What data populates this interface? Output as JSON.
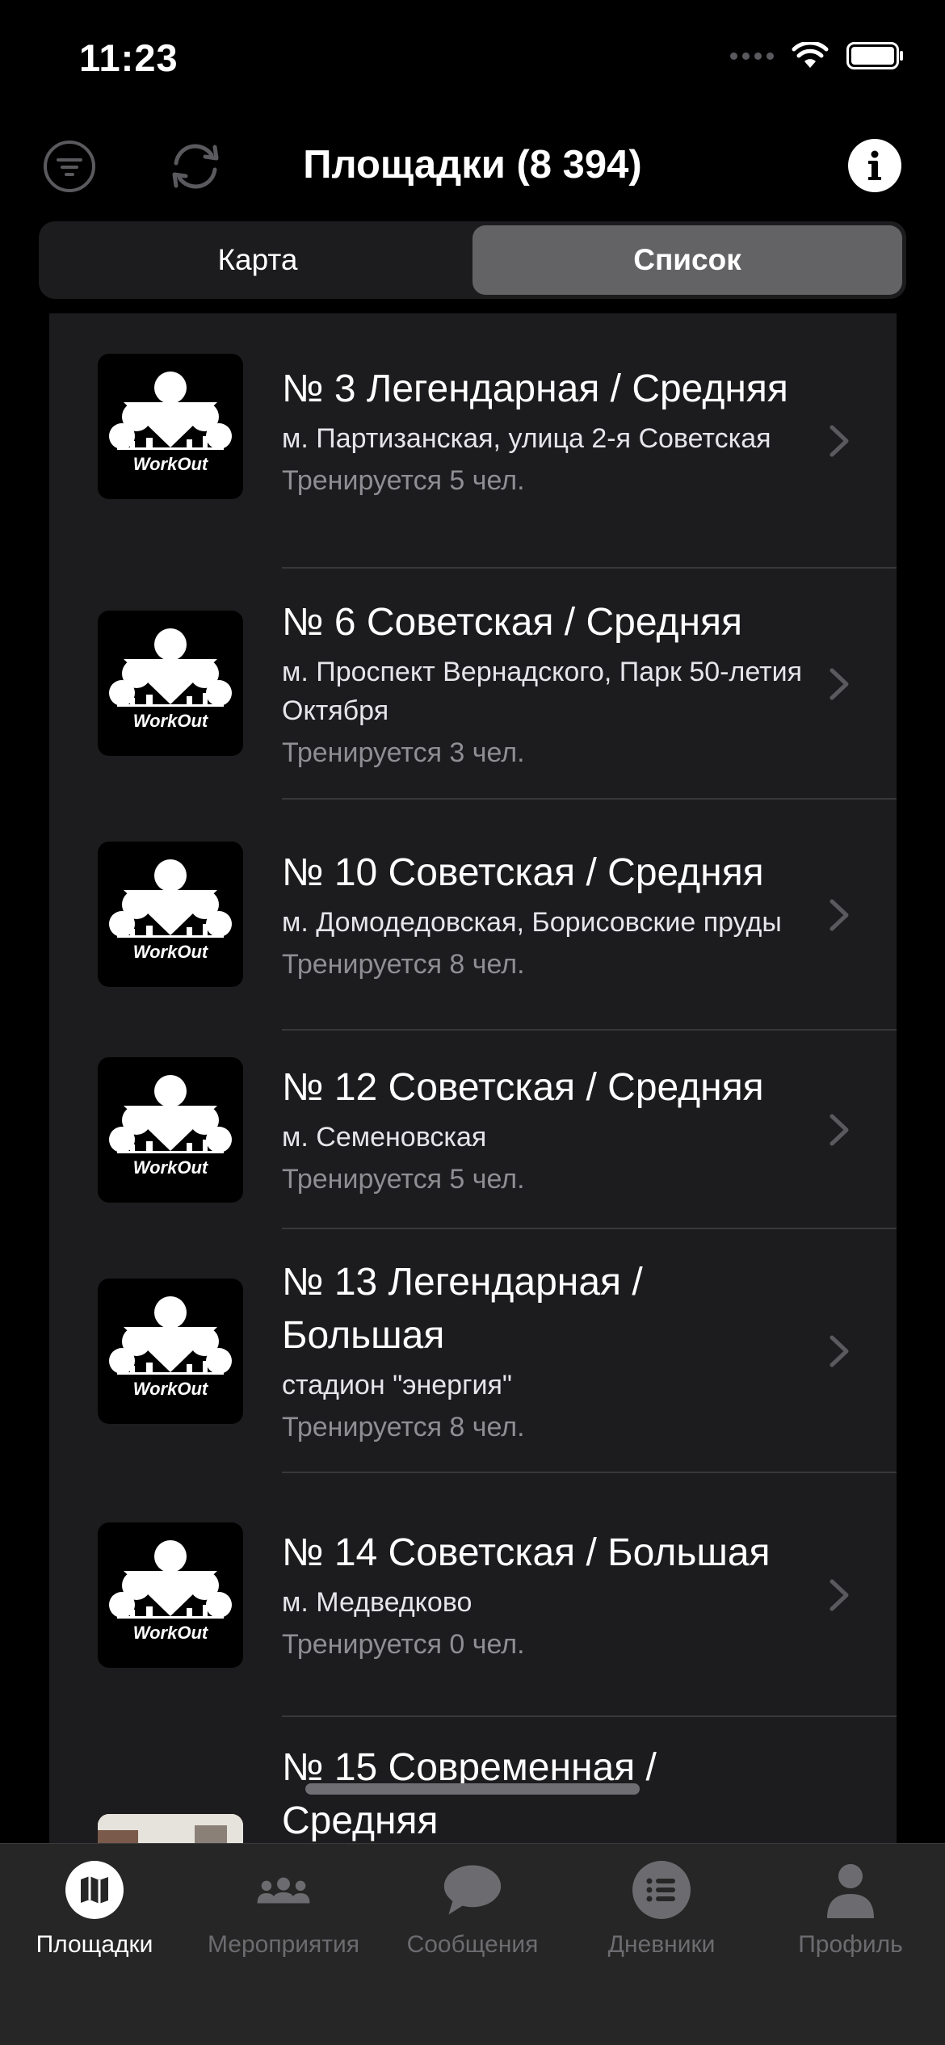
{
  "status_bar": {
    "time": "11:23"
  },
  "nav": {
    "title": "Площадки (8 394)"
  },
  "segments": [
    {
      "label": "Карта",
      "active": false
    },
    {
      "label": "Список",
      "active": true
    }
  ],
  "list": {
    "items": [
      {
        "title": "№ 3 Легендарная / Средняя",
        "address": "м. Партизанская, улица 2-я Советская",
        "count": "Тренируется 5 чел.",
        "image": "workout-logo"
      },
      {
        "title": "№ 6 Советская / Средняя",
        "address": "м. Проспект Вернадского, Парк 50-летия Октября",
        "count": "Тренируется 3 чел.",
        "image": "workout-logo"
      },
      {
        "title": "№ 10 Советская / Средняя",
        "address": "м. Домодедовская, Борисовские пруды",
        "count": "Тренируется 8 чел.",
        "image": "workout-logo"
      },
      {
        "title": "№ 12 Советская / Средняя",
        "address": "м. Семеновская",
        "count": "Тренируется 5 чел.",
        "image": "workout-logo"
      },
      {
        "title": "№ 13 Легендарная / Большая",
        "address": "стадион \"энергия\"",
        "count": "Тренируется 8 чел.",
        "image": "workout-logo"
      },
      {
        "title": "№ 14 Советская / Большая",
        "address": "м. Медведково",
        "count": "Тренируется 0 чел.",
        "image": "workout-logo"
      },
      {
        "title": "№ 15 Современная / Средняя",
        "address": "",
        "count": "",
        "image": "photo"
      }
    ]
  },
  "logo_text": "WorkOut",
  "tab_bar": {
    "tabs": [
      {
        "label": "Площадки",
        "icon": "map-icon",
        "active": true
      },
      {
        "label": "Мероприятия",
        "icon": "people-icon",
        "active": false
      },
      {
        "label": "Сообщения",
        "icon": "message-bubble-icon",
        "active": false
      },
      {
        "label": "Дневники",
        "icon": "list-icon",
        "active": false
      },
      {
        "label": "Профиль",
        "icon": "person-icon",
        "active": false
      }
    ]
  },
  "colors": {
    "background": "#000000",
    "surface": "#1c1c1e",
    "segment_active": "#636366",
    "secondary_text": "#8e8e93",
    "tab_inactive": "#6c6c70"
  }
}
